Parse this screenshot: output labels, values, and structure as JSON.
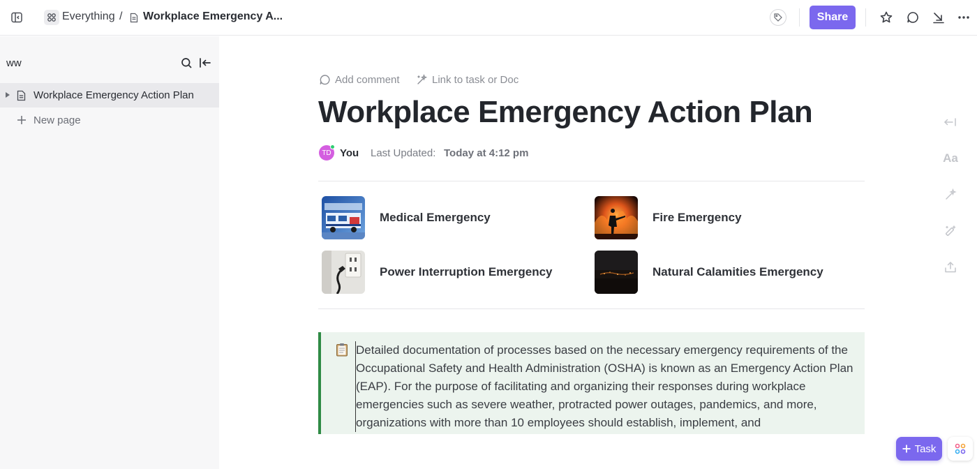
{
  "breadcrumb": {
    "space": "Everything",
    "separator": "/",
    "doc": "Workplace Emergency A..."
  },
  "toolbar": {
    "share_label": "Share",
    "accent_color": "#7b68ee"
  },
  "sidebar": {
    "title": "ww",
    "items": [
      {
        "label": "Workplace Emergency Action Plan",
        "icon": "doc-icon",
        "selected": true
      }
    ],
    "new_page_label": "New page"
  },
  "doc": {
    "actions": {
      "add_comment": "Add comment",
      "link_task": "Link to task or Doc"
    },
    "title": "Workplace Emergency Action Plan",
    "author": {
      "initials": "TD",
      "name": "You",
      "updated_label": "Last Updated:",
      "updated_value": "Today at 4:12 pm"
    },
    "subpages": [
      {
        "label": "Medical Emergency",
        "thumb": "ambulance-image"
      },
      {
        "label": "Fire Emergency",
        "thumb": "firefighter-image"
      },
      {
        "label": "Power Interruption Emergency",
        "thumb": "power-outlet-image"
      },
      {
        "label": "Natural Calamities Emergency",
        "thumb": "night-fire-image"
      }
    ],
    "callout": {
      "icon": "clipboard-icon",
      "text": "Detailed documentation of processes based on the necessary emergency requirements of the Occupational Safety and Health Administration (OSHA) is known as an Emergency Action Plan (EAP). For the purpose of facilitating and organizing their responses during workplace emergencies such as severe weather, protracted power outages, pandemics, and more, organizations with more than 10 employees should establish, implement, and",
      "accent_color": "#2f8a45"
    }
  },
  "right_rail": {
    "font_label": "Aa"
  },
  "fab": {
    "task_label": "Task"
  }
}
